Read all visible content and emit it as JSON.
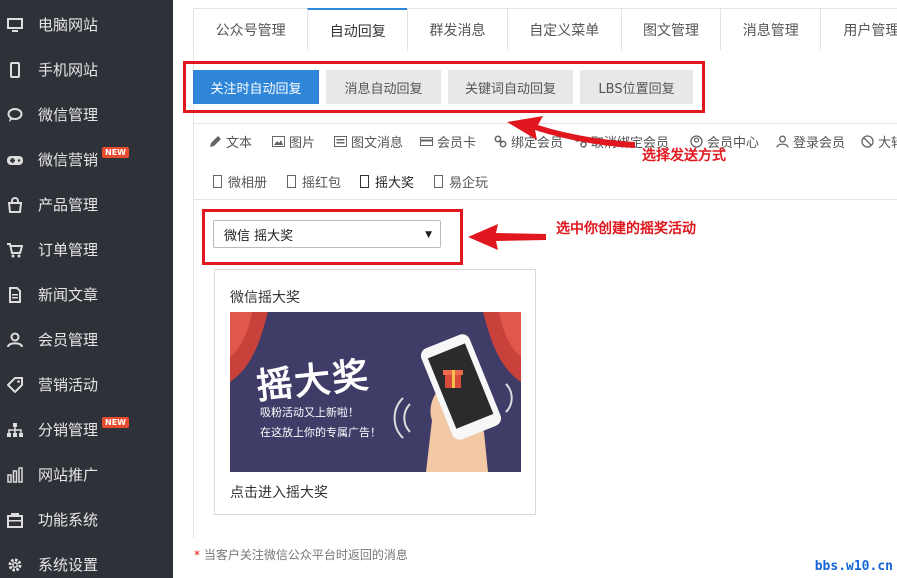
{
  "sidebar": {
    "items": [
      {
        "label": "电脑网站",
        "icon": "monitor-icon"
      },
      {
        "label": "手机网站",
        "icon": "mobile-icon"
      },
      {
        "label": "微信管理",
        "icon": "chat-icon"
      },
      {
        "label": "微信营销",
        "icon": "gamepad-icon",
        "badge": "NEW"
      },
      {
        "label": "产品管理",
        "icon": "bag-icon"
      },
      {
        "label": "订单管理",
        "icon": "cart-icon"
      },
      {
        "label": "新闻文章",
        "icon": "document-icon"
      },
      {
        "label": "会员管理",
        "icon": "user-icon"
      },
      {
        "label": "营销活动",
        "icon": "tag-icon"
      },
      {
        "label": "分销管理",
        "icon": "sitemap-icon",
        "badge": "NEW"
      },
      {
        "label": "网站推广",
        "icon": "bar-chart-icon"
      },
      {
        "label": "功能系统",
        "icon": "toolbox-icon"
      },
      {
        "label": "系统设置",
        "icon": "gear-icon"
      }
    ]
  },
  "tabs": [
    "公众号管理",
    "自动回复",
    "群发消息",
    "自定义菜单",
    "图文管理",
    "消息管理",
    "用户管理"
  ],
  "subtabs": [
    "关注时自动回复",
    "消息自动回复",
    "关键词自动回复",
    "LBS位置回复"
  ],
  "types_row1": [
    "文本",
    "图片",
    "图文消息",
    "会员卡",
    "绑定会员",
    "取消绑定会员",
    "会员中心",
    "登录会员",
    "大转"
  ],
  "types_row2": [
    "微相册",
    "摇红包",
    "摇大奖",
    "易企玩"
  ],
  "select": {
    "value": "微信 摇大奖"
  },
  "card": {
    "title": "微信摇大奖",
    "banner_big": "摇大奖",
    "banner_line1": "吸粉活动又上新啦！",
    "banner_line2": "在这放上你的专属广告！",
    "link": "点击进入摇大奖"
  },
  "note": {
    "star": "*",
    "text": "当客户关注微信公众平台时返回的消息"
  },
  "annotations": {
    "choose_method": "选择发送方式",
    "choose_activity": "选中你创建的摇奖活动"
  },
  "watermark": "bbs.w10.cn",
  "colors": {
    "accent": "#2f86d8",
    "sidebar": "#2f3138",
    "annotation": "#e0171e"
  }
}
